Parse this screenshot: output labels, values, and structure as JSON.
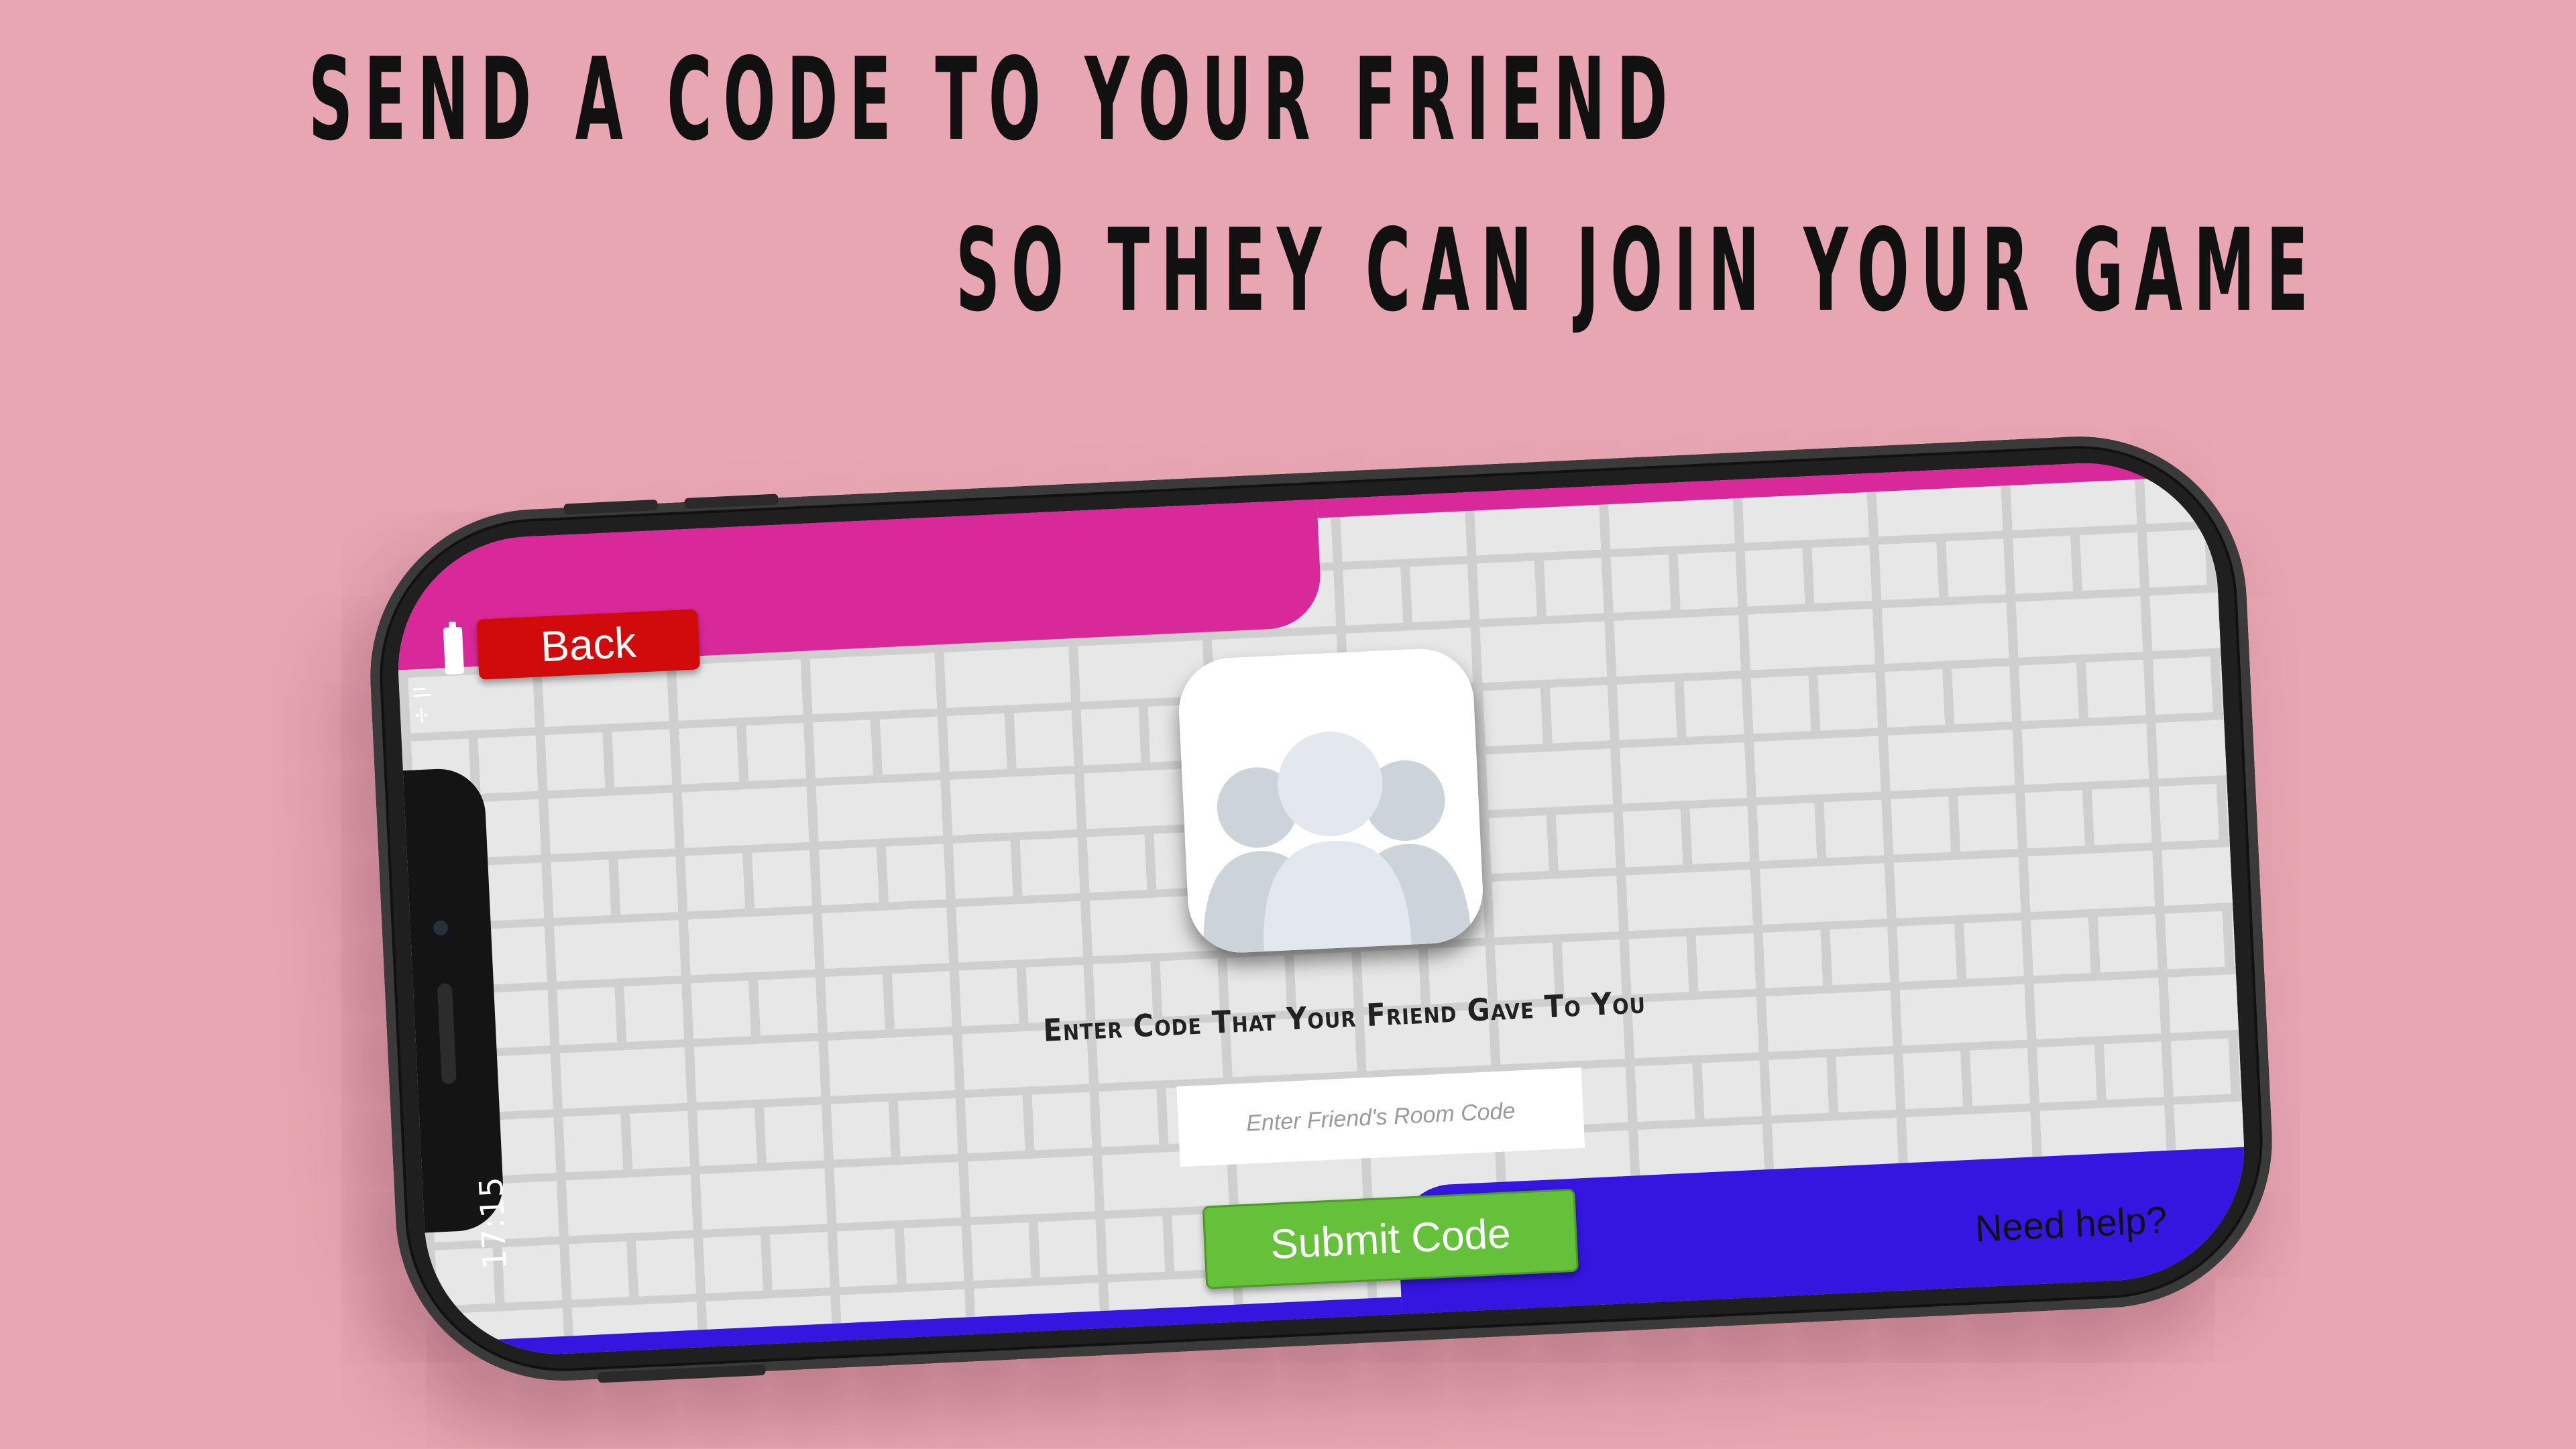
{
  "headline": {
    "line1": "SEND A CODE TO YOUR FRIEND",
    "line2": "SO THEY CAN JOIN YOUR GAME"
  },
  "status_bar": {
    "time": "17:15",
    "signal": "ıl ÷"
  },
  "toolbar": {
    "back_label": "Back"
  },
  "join": {
    "icon": "group-avatar-icon",
    "prompt": "Enter Code That Your Friend Gave To You",
    "input_placeholder": "Enter Friend's Room Code",
    "input_value": "",
    "submit_label": "Submit Code"
  },
  "footer": {
    "help_label": "Need help?"
  },
  "colors": {
    "background": "#e8a6b2",
    "top_band": "#d92899",
    "bottom_band": "#3515e0",
    "back_button": "#d10b0b",
    "submit_button": "#65c03a",
    "wall": "#e7e7e7"
  }
}
